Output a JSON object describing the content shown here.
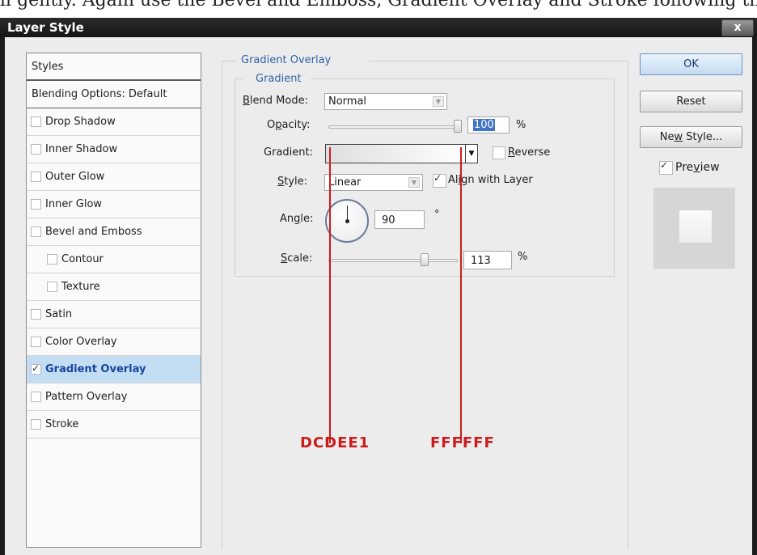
{
  "top_cropped_text": "ll gently. Again use the Bevel and Emboss, Gradient Overlay and Stroke following the picture highlighted below",
  "dialog": {
    "title": "Layer Style",
    "close_glyph": "x"
  },
  "sidebar": {
    "header": "Styles",
    "blending": "Blending Options: Default",
    "items": [
      {
        "label": "Drop Shadow",
        "checked": false
      },
      {
        "label": "Inner Shadow",
        "checked": false
      },
      {
        "label": "Outer Glow",
        "checked": false
      },
      {
        "label": "Inner Glow",
        "checked": false
      },
      {
        "label": "Bevel and Emboss",
        "checked": false
      },
      {
        "label": "Contour",
        "checked": false
      },
      {
        "label": "Texture",
        "checked": false
      },
      {
        "label": "Satin",
        "checked": false
      },
      {
        "label": "Color Overlay",
        "checked": false
      },
      {
        "label": "Gradient Overlay",
        "checked": true
      },
      {
        "label": "Pattern Overlay",
        "checked": false
      },
      {
        "label": "Stroke",
        "checked": false
      }
    ]
  },
  "panel": {
    "section_title": "Gradient Overlay",
    "group_title": "Gradient",
    "blend_mode": {
      "label_pre": "B",
      "label_post": "lend Mode:",
      "value": "Normal"
    },
    "opacity": {
      "label_pre": "O",
      "label_ul": "p",
      "label_post": "acity:",
      "value": "100",
      "unit": "%",
      "level": 1.0
    },
    "gradient": {
      "label": "Gradient:",
      "reverse_pre": "R",
      "reverse_post": "everse",
      "reverse_checked": false,
      "color_start": "#DCDEE1",
      "color_end": "#FFFFFF"
    },
    "style": {
      "label_ul": "S",
      "label_post": "tyle:",
      "value": "Linear",
      "align_pre": "Al",
      "align_ul": "i",
      "align_post": "gn with Layer",
      "align_checked": true
    },
    "angle": {
      "label_pre": "An",
      "label_ul": "g",
      "label_post": "le:",
      "value": "90",
      "unit": "°"
    },
    "scale": {
      "label_ul": "S",
      "label_post": "cale:",
      "value": "113",
      "unit": "%",
      "level": 0.75
    }
  },
  "buttons": {
    "ok": "OK",
    "reset": "Reset",
    "new_style_pre": "Ne",
    "new_style_ul": "w",
    "new_style_post": " Style...",
    "preview_pre": "Pre",
    "preview_ul": "v",
    "preview_post": "iew",
    "preview_checked": true
  },
  "annotations": {
    "left_color": "DCDEE1",
    "right_color": "FFFFFF",
    "line_color": "#d11a1a"
  }
}
